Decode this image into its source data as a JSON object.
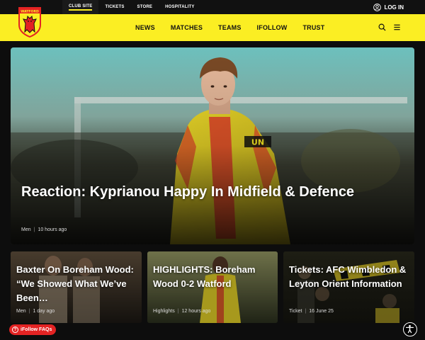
{
  "topnav": {
    "items": [
      {
        "label": "CLUB SITE"
      },
      {
        "label": "TICKETS"
      },
      {
        "label": "STORE"
      },
      {
        "label": "HOSPITALITY"
      }
    ],
    "login_label": "LOG IN"
  },
  "header": {
    "crest_text": "WATFORD",
    "nav": [
      {
        "label": "NEWS"
      },
      {
        "label": "MATCHES"
      },
      {
        "label": "TEAMS"
      },
      {
        "label": "IFOLLOW"
      },
      {
        "label": "TRUST"
      }
    ],
    "icons": [
      "search-icon",
      "menu-icon"
    ]
  },
  "hero": {
    "title": "Reaction: Kyprianou Happy In Midfield & Defence",
    "category": "Men",
    "time": "10 hours ago",
    "shirt_text": "UN"
  },
  "cards": [
    {
      "title": "Baxter On Boreham Wood: “We Showed What We’ve Been…",
      "category": "Men",
      "time": "1 day ago"
    },
    {
      "title": "HIGHLIGHTS: Boreham Wood 0-2 Watford",
      "category": "Highlights",
      "time": "12 hours ago"
    },
    {
      "title": "Tickets: AFC Wimbledon & Leyton Orient Information",
      "category": "Ticket",
      "time": "16 June 25"
    }
  ],
  "floating": {
    "faq_label": "iFollow FAQs"
  },
  "colors": {
    "brand_yellow": "#fbee23",
    "brand_red": "#e32323",
    "brand_black": "#111111"
  }
}
